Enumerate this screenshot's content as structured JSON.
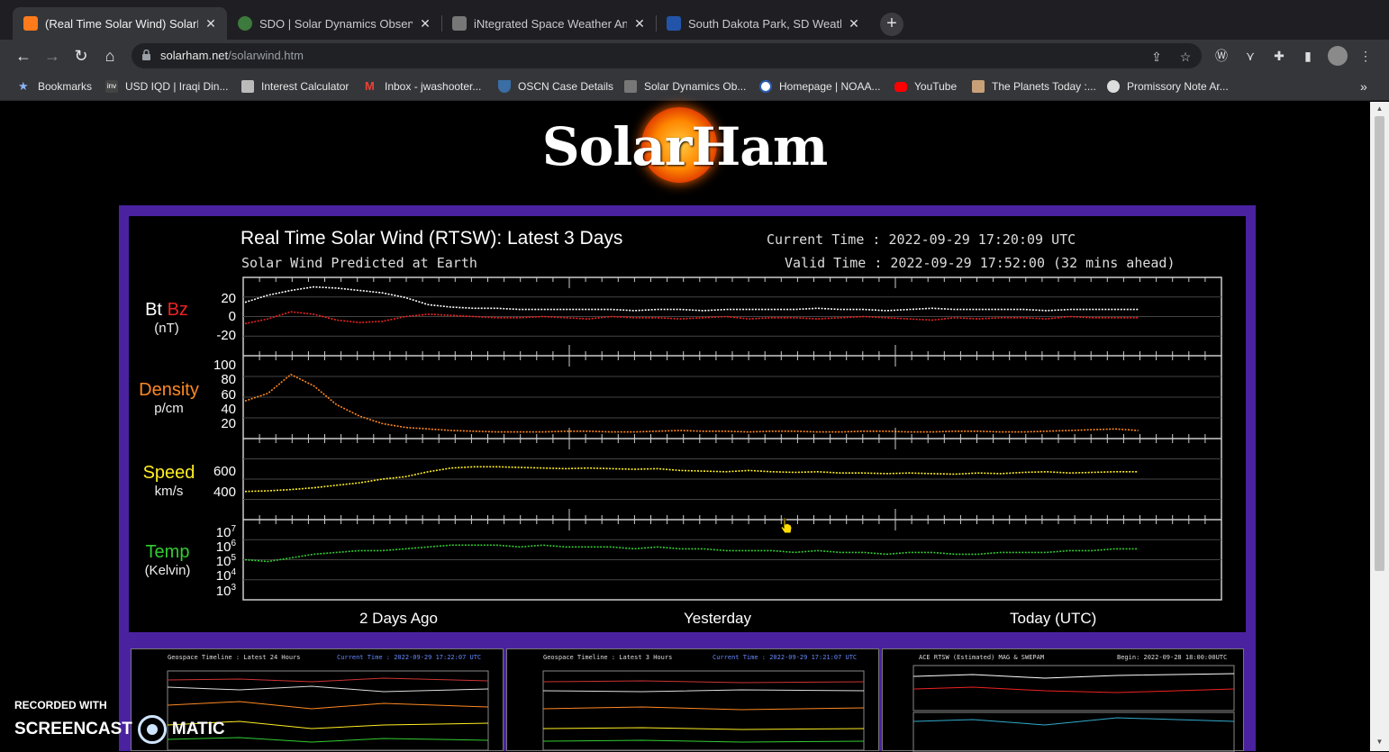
{
  "browser": {
    "tabs": [
      {
        "title": "(Real Time Solar Wind) SolarHam",
        "active": true,
        "favicon_color": "#ff7a1a"
      },
      {
        "title": "SDO | Solar Dynamics Observato",
        "active": false,
        "favicon_color": "#3d7a3d"
      },
      {
        "title": "iNtegrated Space Weather Analy",
        "active": false,
        "favicon_color": "#777777"
      },
      {
        "title": "South Dakota Park, SD Weather",
        "active": false,
        "favicon_color": "#2255aa"
      }
    ],
    "url_host": "solarham.net",
    "url_path": "/solarwind.htm",
    "bookmarks": [
      {
        "label": "Bookmarks",
        "icon": "star-icon"
      },
      {
        "label": "USD IQD | Iraqi Din...",
        "icon": "inv-icon"
      },
      {
        "label": "Interest Calculator",
        "icon": "calculator-icon"
      },
      {
        "label": "Inbox - jwashooter...",
        "icon": "gmail-icon"
      },
      {
        "label": "OSCN Case Details",
        "icon": "shield-icon"
      },
      {
        "label": "Solar Dynamics Ob...",
        "icon": "satellite-icon"
      },
      {
        "label": "Homepage | NOAA...",
        "icon": "noaa-icon"
      },
      {
        "label": "YouTube",
        "icon": "youtube-icon"
      },
      {
        "label": "The Planets Today :...",
        "icon": "planets-icon"
      },
      {
        "label": "Promissory Note Ar...",
        "icon": "document-icon"
      }
    ]
  },
  "page": {
    "logo_text": "SolarHam",
    "panel": {
      "title": "Real Time Solar Wind (RTSW): Latest 3 Days",
      "subtitle": "Solar Wind Predicted at Earth",
      "current_time": "Current Time : 2022-09-29 17:20:09 UTC",
      "valid_time": "Valid Time : 2022-09-29 17:52:00 (32 mins ahead)"
    },
    "watermark": {
      "line1": "RECORDED WITH",
      "line2a": "SCREENCAST",
      "line2b": "MATIC"
    }
  },
  "chart_data": {
    "type": "line",
    "title": "Real Time Solar Wind (RTSW): Latest 3 Days",
    "x_labels": [
      "2 Days Ago",
      "Yesterday",
      "Today (UTC)"
    ],
    "grid": true,
    "panels": [
      {
        "label": "Bt",
        "label2": "Bz",
        "unit": "(nT)",
        "label_color": "#ffffff",
        "label2_color": "#ee2222",
        "ticks": [
          "20",
          "0",
          "-20"
        ],
        "ylim": [
          -30,
          30
        ],
        "series": [
          {
            "name": "Bt",
            "color": "#ffffff",
            "values": [
              12,
              18,
              22,
              25,
              24,
              22,
              20,
              16,
              10,
              8,
              7,
              7,
              6,
              6,
              6,
              6,
              6,
              5,
              6,
              6,
              5,
              6,
              6,
              6,
              6,
              7,
              6,
              6,
              5,
              6,
              7,
              6,
              6,
              6,
              6,
              5,
              6,
              6,
              6,
              6
            ]
          },
          {
            "name": "Bz",
            "color": "#ee2222",
            "values": [
              -6,
              -2,
              4,
              2,
              -3,
              -5,
              -4,
              0,
              2,
              1,
              0,
              -1,
              -1,
              0,
              -1,
              -2,
              0,
              -1,
              -1,
              -2,
              -1,
              0,
              -2,
              -1,
              -1,
              -2,
              -1,
              0,
              -1,
              -2,
              -3,
              -1,
              -2,
              -1,
              -1,
              -2,
              0,
              -1,
              -1,
              -1
            ]
          }
        ]
      },
      {
        "label": "Density",
        "unit": "p/cm",
        "label_color": "#ff8822",
        "ticks": [
          "100",
          "80",
          "60",
          "40",
          "20"
        ],
        "ylim": [
          0,
          100
        ],
        "series": [
          {
            "name": "Density",
            "color": "#ff8822",
            "values": [
              45,
              55,
              80,
              65,
              40,
              25,
              15,
              10,
              8,
              6,
              5,
              4,
              4,
              4,
              5,
              5,
              4,
              4,
              5,
              6,
              5,
              5,
              4,
              5,
              5,
              4,
              4,
              5,
              5,
              4,
              4,
              5,
              5,
              4,
              4,
              5,
              6,
              7,
              8,
              6
            ]
          }
        ]
      },
      {
        "label": "Speed",
        "unit": "km/s",
        "label_color": "#ffee22",
        "ticks": [
          "600",
          "400"
        ],
        "ylim": [
          200,
          800
        ],
        "series": [
          {
            "name": "Speed",
            "color": "#ffee22",
            "values": [
              400,
              405,
              415,
              430,
              450,
              470,
              500,
              520,
              560,
              590,
              600,
              600,
              595,
              590,
              585,
              590,
              585,
              580,
              585,
              570,
              565,
              560,
              570,
              560,
              555,
              560,
              550,
              550,
              545,
              550,
              545,
              540,
              550,
              545,
              555,
              560,
              550,
              555,
              560,
              560
            ]
          }
        ]
      },
      {
        "label": "Temp",
        "unit": "(Kelvin)",
        "label_color": "#33cc33",
        "ticks": [
          "7",
          "6",
          "5",
          "4",
          "3"
        ],
        "log": true,
        "ylim": [
          1000,
          10000000
        ],
        "series": [
          {
            "name": "Temp",
            "color": "#33cc33",
            "values": [
              5.0,
              4.9,
              5.1,
              5.3,
              5.4,
              5.5,
              5.5,
              5.6,
              5.7,
              5.8,
              5.8,
              5.8,
              5.7,
              5.8,
              5.7,
              5.7,
              5.7,
              5.6,
              5.7,
              5.6,
              5.6,
              5.5,
              5.5,
              5.5,
              5.4,
              5.5,
              5.4,
              5.4,
              5.3,
              5.4,
              5.4,
              5.3,
              5.3,
              5.4,
              5.4,
              5.4,
              5.5,
              5.5,
              5.6,
              5.6
            ]
          }
        ]
      }
    ],
    "thumbnails": [
      {
        "title": "Geospace Timeline : Latest 24 Hours",
        "time": "Current Time : 2022-09-29 17:22:07 UTC"
      },
      {
        "title": "Geospace Timeline : Latest 3 Hours",
        "time": "Current Time : 2022-09-29 17:21:07 UTC"
      },
      {
        "title": "ACE RTSW (Estimated) MAG & SWEPAM",
        "time": "Begin: 2022-09-28 18:00:00UTC"
      }
    ]
  }
}
